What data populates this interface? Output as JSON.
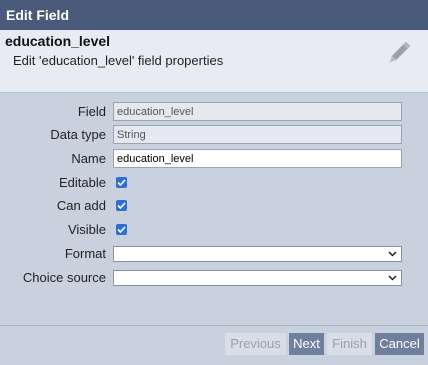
{
  "dialog": {
    "title": "Edit Field"
  },
  "header": {
    "field_name": "education_level",
    "description": "Edit 'education_level' field properties",
    "icon": "pencil-icon"
  },
  "form": {
    "field": {
      "label": "Field",
      "value": "education_level"
    },
    "data_type": {
      "label": "Data type",
      "value": "String"
    },
    "name": {
      "label": "Name",
      "value": "education_level"
    },
    "editable": {
      "label": "Editable",
      "checked": true
    },
    "can_add": {
      "label": "Can add",
      "checked": true
    },
    "visible": {
      "label": "Visible",
      "checked": true
    },
    "format": {
      "label": "Format",
      "selected": ""
    },
    "choice_source": {
      "label": "Choice source",
      "selected": ""
    }
  },
  "footer": {
    "previous_label": "Previous",
    "next_label": "Next",
    "finish_label": "Finish",
    "cancel_label": "Cancel"
  },
  "colors": {
    "titlebar": "#4a5a7a",
    "panel": "#c9d1df",
    "active_button": "#6f7fa0",
    "checkbox": "#2f6fd6"
  }
}
